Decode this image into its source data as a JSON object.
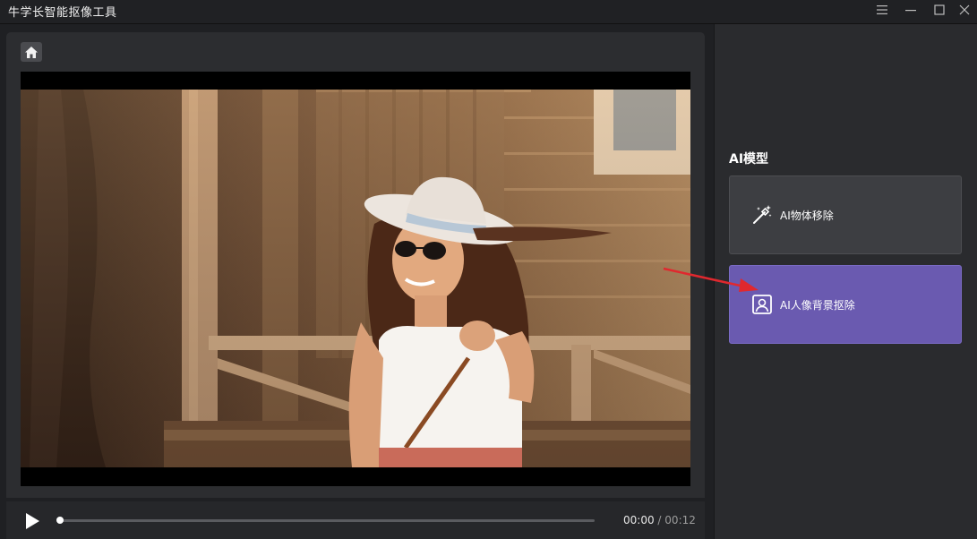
{
  "window": {
    "title": "牛学长智能抠像工具"
  },
  "player": {
    "current_time": "00:00",
    "separator": "/",
    "total_time": "00:12",
    "progress": 0.0
  },
  "panel": {
    "section_title": "AI模型",
    "models": [
      {
        "label": "AI物体移除",
        "icon": "magic-wand-icon"
      },
      {
        "label": "AI人像背景抠除",
        "icon": "portrait-icon"
      }
    ]
  },
  "colors": {
    "selected_card": "#6a5ab0",
    "card": "#3d3e42",
    "annotation_arrow": "#e0282e"
  }
}
